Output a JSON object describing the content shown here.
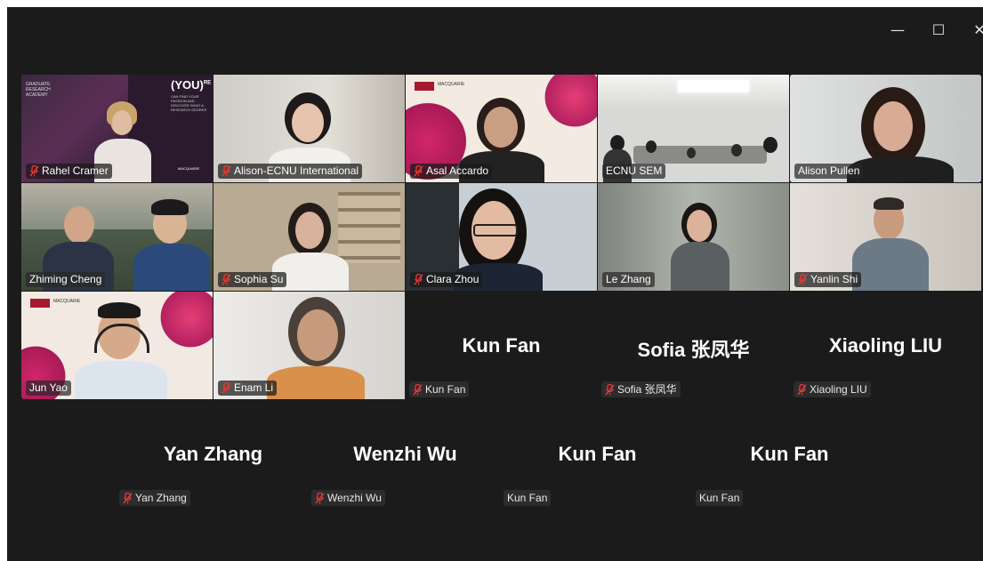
{
  "window": {
    "controls": {
      "minimize": "—",
      "maximize": "☐",
      "close": "✕"
    }
  },
  "video_tiles": [
    {
      "name": "Rahel Cramer",
      "muted": true
    },
    {
      "name": "Alison-ECNU International",
      "muted": true
    },
    {
      "name": "Asal Accardo",
      "muted": true
    },
    {
      "name": "ECNU SEM",
      "muted": false
    },
    {
      "name": "Alison Pullen",
      "muted": false,
      "active_speaker": true
    },
    {
      "name": "Zhiming Cheng",
      "muted": false
    },
    {
      "name": "Sophia Su",
      "muted": true
    },
    {
      "name": "Clara Zhou",
      "muted": true
    },
    {
      "name": "Le Zhang",
      "muted": false
    },
    {
      "name": "Yanlin Shi",
      "muted": true
    },
    {
      "name": "Jun Yao",
      "muted": false
    },
    {
      "name": "Enam Li",
      "muted": true
    }
  ],
  "tile_overlay_text": {
    "academy": "GRADUATE RESEARCH ACADEMY",
    "you_badge": "(YOU)",
    "you_superscript": "RE",
    "you_tagline": "CAN FIND YOUR PASSION AND DISCOVER WHAT A RESEARCH DEGREE",
    "macquarie": "MACQUARIE"
  },
  "camera_off_row1": [
    {
      "display_name": "Kun Fan",
      "label": "Kun Fan",
      "muted": true
    },
    {
      "display_name": "Sofia 张凤华",
      "label": "Sofia 张凤华",
      "muted": true
    },
    {
      "display_name": "Xiaoling LIU",
      "label": "Xiaoling LIU",
      "muted": true
    }
  ],
  "camera_off_row2": [
    {
      "display_name": "Yan Zhang",
      "label": "Yan Zhang",
      "muted": true
    },
    {
      "display_name": "Wenzhi Wu",
      "label": "Wenzhi Wu",
      "muted": true
    },
    {
      "display_name": "Kun Fan",
      "label": "Kun Fan",
      "muted": false
    },
    {
      "display_name": "Kun Fan",
      "label": "Kun Fan",
      "muted": false
    }
  ],
  "colors": {
    "background": "#1b1b1b",
    "active_speaker_border": "#3fd17f",
    "muted_icon": "#e53935"
  }
}
